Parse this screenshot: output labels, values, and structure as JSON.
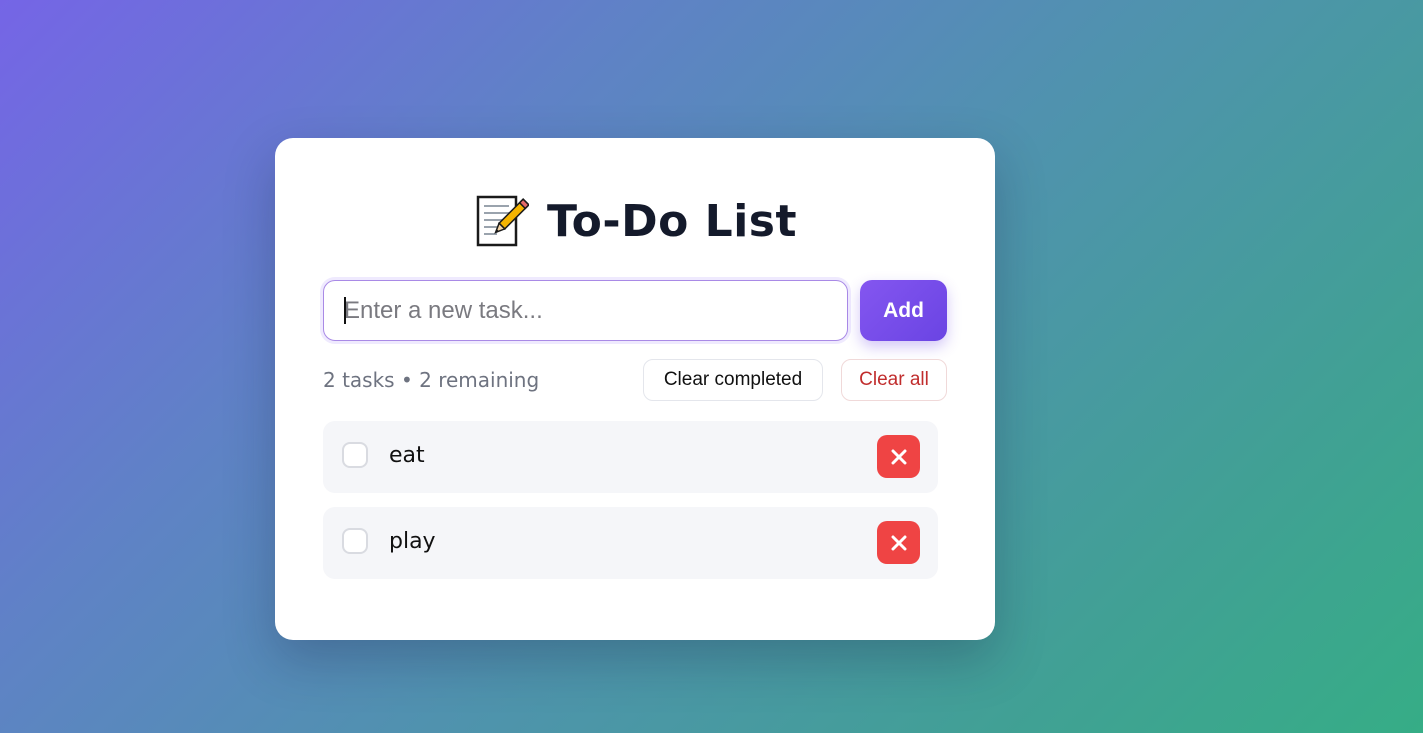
{
  "app": {
    "title": "To-Do List",
    "title_icon": "memo-icon"
  },
  "input": {
    "placeholder": "Enter a new task...",
    "value": ""
  },
  "add_button": {
    "label": "Add"
  },
  "stats": {
    "text": "2 tasks • 2 remaining",
    "total": 2,
    "remaining": 2
  },
  "actions": {
    "clear_completed_label": "Clear completed",
    "clear_all_label": "Clear all"
  },
  "tasks": [
    {
      "text": "eat",
      "completed": false,
      "delete_icon": "close-icon"
    },
    {
      "text": "play",
      "completed": false,
      "delete_icon": "close-icon"
    }
  ],
  "colors": {
    "accent": "#7c4dff",
    "danger": "#ef4444",
    "clear_all_text": "#c12d2d",
    "gradient_start": "#7565e6",
    "gradient_end": "#36ad86"
  }
}
